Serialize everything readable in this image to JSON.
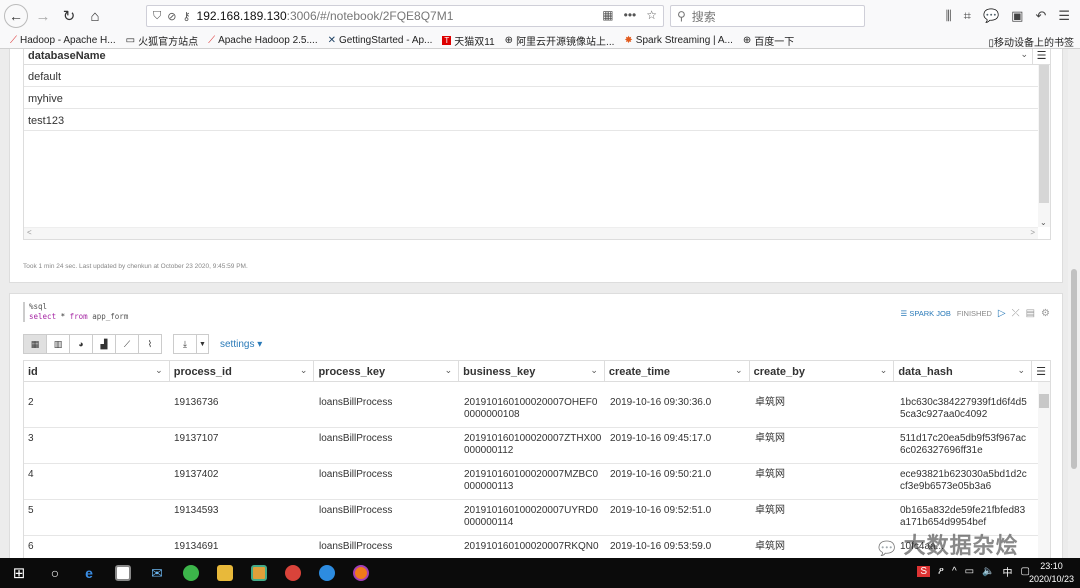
{
  "browser": {
    "url_host": "192.168.189.130",
    "url_path": ":3006/#/notebook/2FQE8Q7M1",
    "search_placeholder": "搜索",
    "bookmarks": [
      {
        "label": "Hadoop - Apache H..."
      },
      {
        "label": "火狐官方站点"
      },
      {
        "label": "Apache Hadoop 2.5...."
      },
      {
        "label": "GettingStarted - Ap..."
      },
      {
        "label": "天猫双11"
      },
      {
        "label": "阿里云开源镜像站上..."
      },
      {
        "label": "Spark Streaming | A..."
      },
      {
        "label": "百度一下"
      }
    ],
    "mobile_bookmarks": "移动设备上的书签"
  },
  "paragraph1": {
    "column": "databaseName",
    "rows": [
      "default",
      "myhive",
      "test123"
    ],
    "footer": "Took 1 min 24 sec. Last updated by chenkun at October 23 2020, 9:45:59 PM."
  },
  "paragraph2": {
    "code_line1": "%sql",
    "code_select": "select",
    "code_star": "*",
    "code_from": "from",
    "code_table": "app_form",
    "job_label": "SPARK JOB",
    "job_status": "FINISHED",
    "settings_label": "settings",
    "columns": [
      "id",
      "process_id",
      "process_key",
      "business_key",
      "create_time",
      "create_by",
      "data_hash"
    ],
    "rows": [
      {
        "id": "2",
        "process_id": "19136736",
        "process_key": "loansBillProcess",
        "business_key": "201910160100020007OHEF00000000108",
        "create_time": "2019-10-16 09:30:36.0",
        "create_by": "卓筑网",
        "data_hash": "1bc630c384227939f1d6f4d55ca3c927aa0c4092"
      },
      {
        "id": "3",
        "process_id": "19137107",
        "process_key": "loansBillProcess",
        "business_key": "201910160100020007ZTHX00000000112",
        "create_time": "2019-10-16 09:45:17.0",
        "create_by": "卓筑网",
        "data_hash": "511d17c20ea5db9f53f967ac6c026327696ff31e"
      },
      {
        "id": "4",
        "process_id": "19137402",
        "process_key": "loansBillProcess",
        "business_key": "201910160100020007MZBC0000000113",
        "create_time": "2019-10-16 09:50:21.0",
        "create_by": "卓筑网",
        "data_hash": "ece93821b623030a5bd1d2ccf3e9b6573e05b3a6"
      },
      {
        "id": "5",
        "process_id": "19134593",
        "process_key": "loansBillProcess",
        "business_key": "201910160100020007UYRD0000000114",
        "create_time": "2019-10-16 09:52:51.0",
        "create_by": "卓筑网",
        "data_hash": "0b165a832de59fe21fbfed83a171b654d9954bef"
      },
      {
        "id": "6",
        "process_id": "19134691",
        "process_key": "loansBillProcess",
        "business_key": "201910160100020007RKQN0",
        "create_time": "2019-10-16 09:53:59.0",
        "create_by": "卓筑网",
        "data_hash": "10fc4aa..."
      }
    ]
  },
  "watermark": "大数据杂烩",
  "taskbar": {
    "time": "23:10",
    "date": "2020/10/23",
    "ime": "中"
  }
}
